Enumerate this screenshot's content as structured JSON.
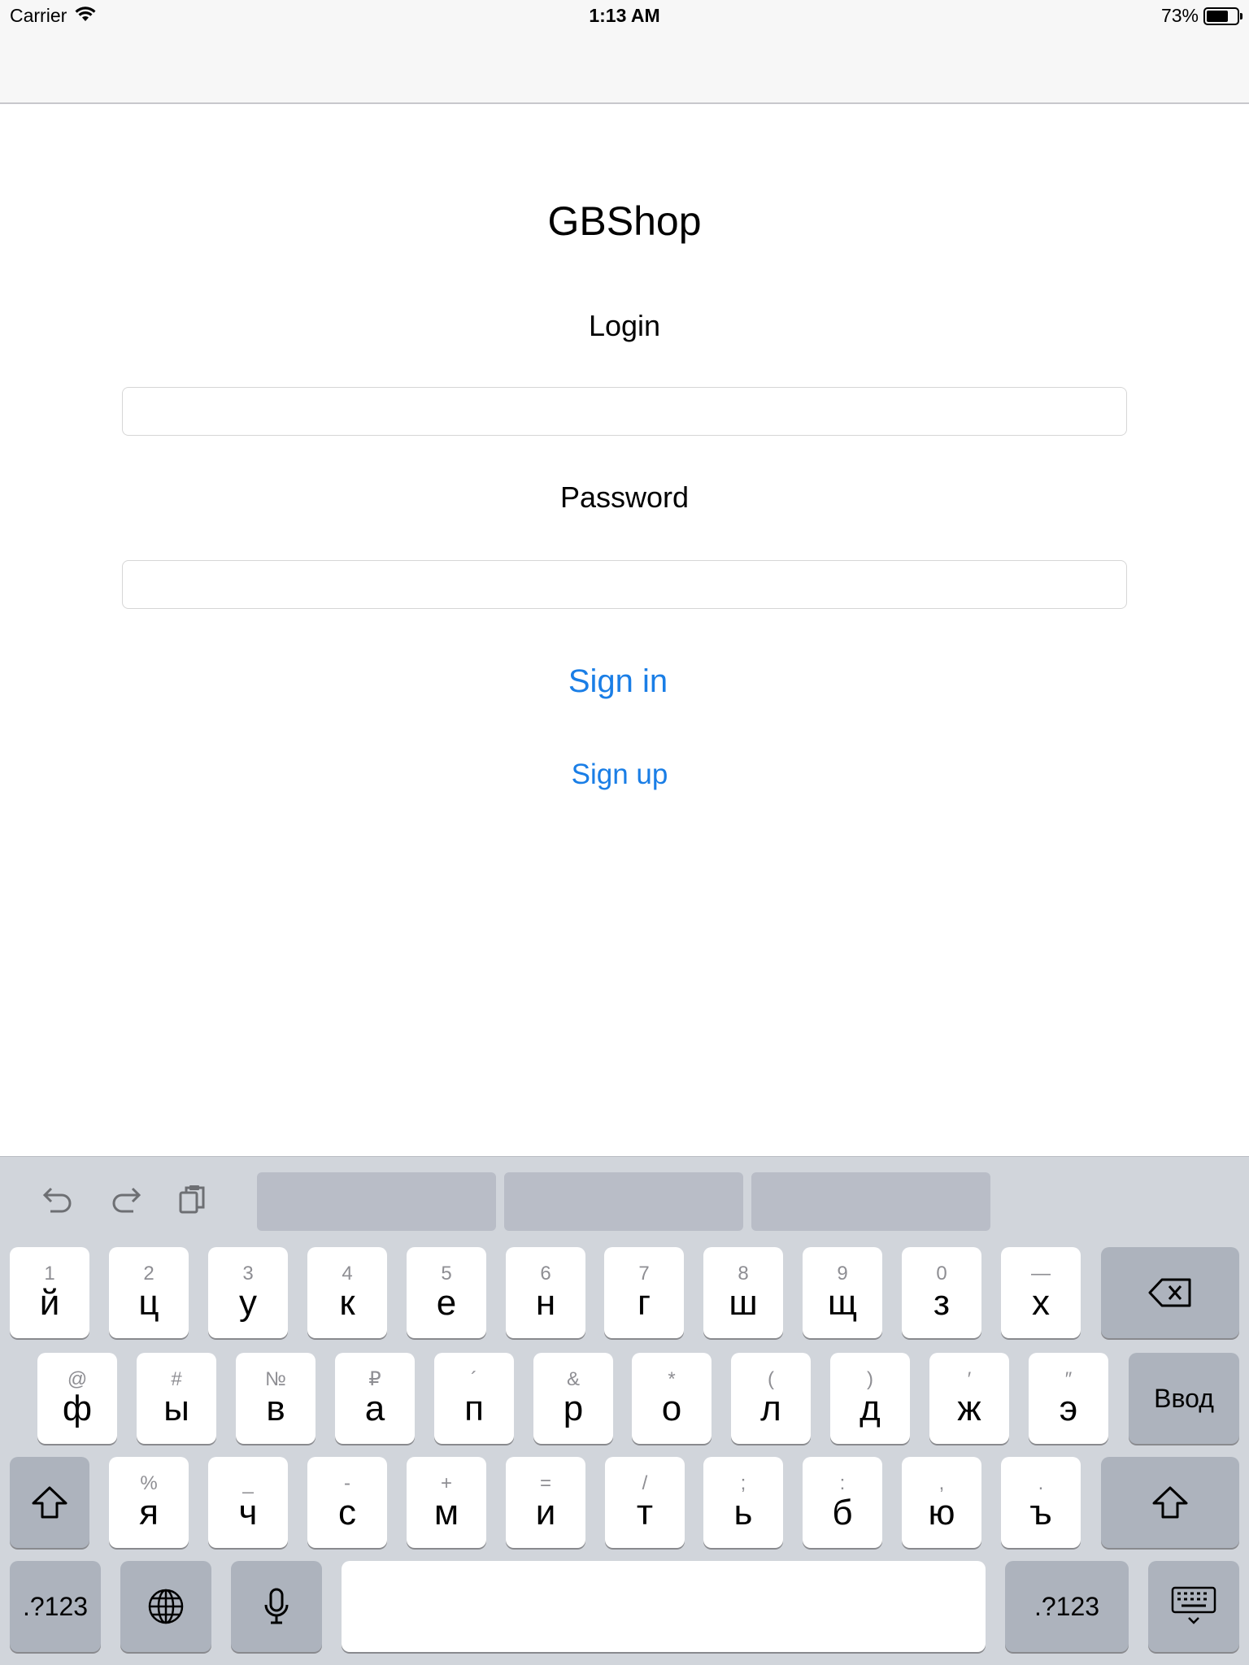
{
  "status": {
    "carrier": "Carrier",
    "time": "1:13 AM",
    "battery": "73%",
    "battery_level": 0.73
  },
  "app": {
    "title": "GBShop",
    "login_label": "Login",
    "login_value": "",
    "password_label": "Password",
    "password_value": "",
    "sign_in": "Sign in",
    "sign_up": "Sign up"
  },
  "keyboard": {
    "row1": [
      {
        "alt": "1",
        "main": "й"
      },
      {
        "alt": "2",
        "main": "ц"
      },
      {
        "alt": "3",
        "main": "у"
      },
      {
        "alt": "4",
        "main": "к"
      },
      {
        "alt": "5",
        "main": "е"
      },
      {
        "alt": "6",
        "main": "н"
      },
      {
        "alt": "7",
        "main": "г"
      },
      {
        "alt": "8",
        "main": "ш"
      },
      {
        "alt": "9",
        "main": "щ"
      },
      {
        "alt": "0",
        "main": "з"
      },
      {
        "alt": "—",
        "main": "х"
      }
    ],
    "row2": [
      {
        "alt": "@",
        "main": "ф"
      },
      {
        "alt": "#",
        "main": "ы"
      },
      {
        "alt": "№",
        "main": "в"
      },
      {
        "alt": "₽",
        "main": "а"
      },
      {
        "alt": "´",
        "main": "п"
      },
      {
        "alt": "&",
        "main": "р"
      },
      {
        "alt": "*",
        "main": "о"
      },
      {
        "alt": "(",
        "main": "л"
      },
      {
        "alt": ")",
        "main": "д"
      },
      {
        "alt": "′",
        "main": "ж"
      },
      {
        "alt": "″",
        "main": "э"
      }
    ],
    "row3": [
      {
        "alt": "%",
        "main": "я"
      },
      {
        "alt": "_",
        "main": "ч"
      },
      {
        "alt": "-",
        "main": "с"
      },
      {
        "alt": "+",
        "main": "м"
      },
      {
        "alt": "=",
        "main": "и"
      },
      {
        "alt": "/",
        "main": "т"
      },
      {
        "alt": ";",
        "main": "ь"
      },
      {
        "alt": ":",
        "main": "б"
      },
      {
        "alt": ",",
        "main": "ю"
      },
      {
        "alt": ".",
        "main": "ъ"
      }
    ],
    "enter_label": "Ввод",
    "numbers_label": ".?123",
    "icons": {
      "undo": "undo-icon",
      "redo": "redo-icon",
      "paste": "paste-icon",
      "backspace": "backspace-icon",
      "shift": "shift-icon",
      "globe": "globe-icon",
      "mic": "microphone-icon",
      "dismiss": "keyboard-dismiss-icon"
    }
  }
}
